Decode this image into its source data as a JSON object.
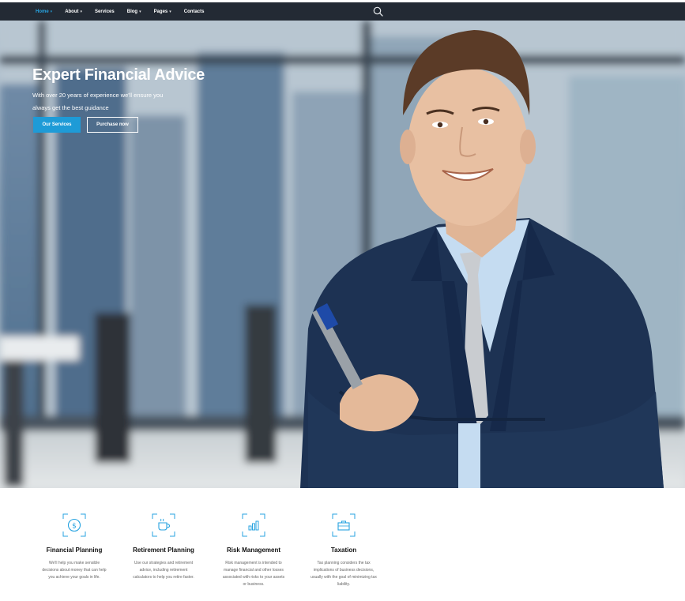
{
  "nav": {
    "items": [
      {
        "label": "Home",
        "dropdown": true,
        "active": true
      },
      {
        "label": "About",
        "dropdown": true,
        "active": false
      },
      {
        "label": "Services",
        "dropdown": false,
        "active": false
      },
      {
        "label": "Blog",
        "dropdown": true,
        "active": false
      },
      {
        "label": "Pages",
        "dropdown": true,
        "active": false
      },
      {
        "label": "Contacts",
        "dropdown": false,
        "active": false
      }
    ],
    "search_icon": "search-icon"
  },
  "hero": {
    "title": "Expert Financial Advice",
    "subtitle": "With over 20 years of experience we'll ensure you always get the best guidance",
    "primary_button": "Our Services",
    "secondary_button": "Purchase now"
  },
  "services": [
    {
      "title": "Financial Planning",
      "icon": "dollar-coin-icon",
      "text": "We'll help you make sensible decisions about money that can help you achieve your goals in life."
    },
    {
      "title": "Retirement Planning",
      "icon": "coffee-cup-icon",
      "text": "Use our strategies and retirement advice, including retirement calculators to help you retire faster."
    },
    {
      "title": "Risk Management",
      "icon": "bar-chart-icon",
      "text": "Risk management is intended to manage financial and other losses associated with risks to your assets or business."
    },
    {
      "title": "Taxation",
      "icon": "briefcase-icon",
      "text": "Tax planning considers the tax implications of business decisions, usually with the goal of minimizing tax liability."
    }
  ],
  "colors": {
    "accent": "#1e9bd7",
    "nav_bg": "#232a34",
    "icon": "#27a3e0"
  }
}
